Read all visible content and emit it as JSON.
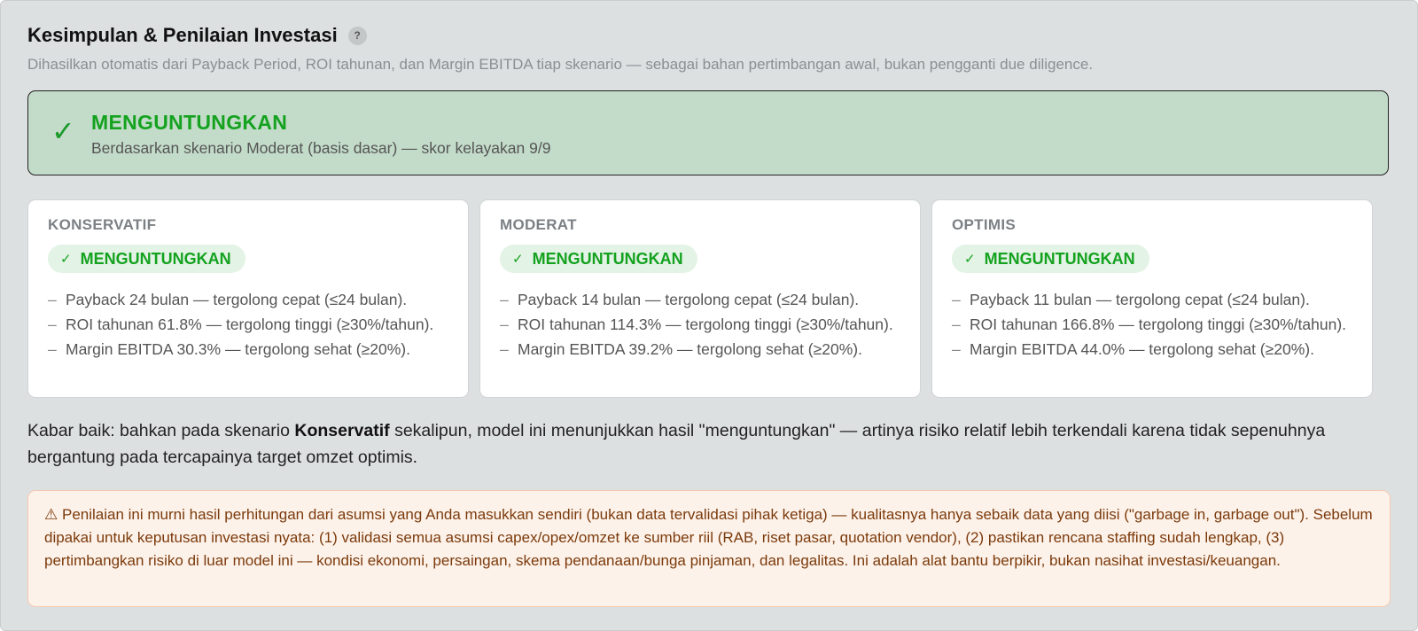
{
  "header": {
    "title": "Kesimpulan & Penilaian Investasi",
    "help_label": "?",
    "subtitle": "Dihasilkan otomatis dari Payback Period, ROI tahunan, dan Margin EBITDA tiap skenario — sebagai bahan pertimbangan awal, bukan pengganti due diligence."
  },
  "verdict": {
    "icon": "✓",
    "title": "MENGUNTUNGKAN",
    "subtitle": "Berdasarkan skenario Moderat (basis dasar) — skor kelayakan 9/9"
  },
  "scenarios": [
    {
      "name": "KONSERVATIF",
      "badge_icon": "✓",
      "badge": "MENGUNTUNGKAN",
      "reasons": [
        "Payback 24 bulan — tergolong cepat (≤24 bulan).",
        "ROI tahunan 61.8% — tergolong tinggi (≥30%/tahun).",
        "Margin EBITDA 30.3% — tergolong sehat (≥20%)."
      ]
    },
    {
      "name": "MODERAT",
      "badge_icon": "✓",
      "badge": "MENGUNTUNGKAN",
      "reasons": [
        "Payback 14 bulan — tergolong cepat (≤24 bulan).",
        "ROI tahunan 114.3% — tergolong tinggi (≥30%/tahun).",
        "Margin EBITDA 39.2% — tergolong sehat (≥20%)."
      ]
    },
    {
      "name": "OPTIMIS",
      "badge_icon": "✓",
      "badge": "MENGUNTUNGKAN",
      "reasons": [
        "Payback 11 bulan — tergolong cepat (≤24 bulan).",
        "ROI tahunan 166.8% — tergolong tinggi (≥30%/tahun).",
        "Margin EBITDA 44.0% — tergolong sehat (≥20%)."
      ]
    }
  ],
  "good_news": {
    "prefix": "Kabar baik: bahkan pada skenario ",
    "emphasis": "Konservatif",
    "suffix": " sekalipun, model ini menunjukkan hasil \"menguntungkan\" — artinya risiko relatif lebih terkendali karena tidak sepenuhnya bergantung pada tercapainya target omzet optimis."
  },
  "warning": {
    "icon": "⚠",
    "text": "Penilaian ini murni hasil perhitungan dari asumsi yang Anda masukkan sendiri (bukan data tervalidasi pihak ketiga) — kualitasnya hanya sebaik data yang diisi (\"garbage in, garbage out\"). Sebelum dipakai untuk keputusan investasi nyata: (1) validasi semua asumsi capex/opex/omzet ke sumber riil (RAB, riset pasar, quotation vendor), (2) pastikan rencana staffing sudah lengkap, (3) pertimbangkan risiko di luar model ini — kondisi ekonomi, persaingan, skema pendanaan/bunga pinjaman, dan legalitas. Ini adalah alat bantu berpikir, bukan nasihat investasi/keuangan."
  },
  "colors": {
    "panel_bg": "#dde0e1",
    "verdict_bg": "#c3dbc9",
    "positive_green": "#14a21f",
    "warning_bg": "#fdf2e9",
    "warning_text": "#7b3a0c"
  }
}
